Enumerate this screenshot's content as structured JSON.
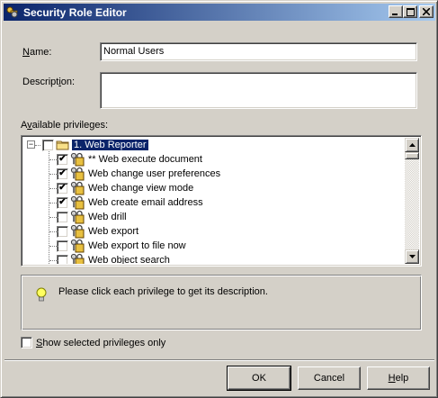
{
  "window": {
    "title": "Security Role Editor",
    "icon": "keys-role-icon",
    "controls": {
      "minimize": "_",
      "maximize": "□",
      "close": "×"
    }
  },
  "form": {
    "name_label": "Name:",
    "name_value": "Normal Users",
    "description_label": "Description:",
    "description_value": "",
    "privileges_label": "Available privileges:"
  },
  "tree": {
    "root": {
      "label": "1. Web Reporter",
      "checked": false,
      "expanded": true,
      "expander": "−",
      "icon": "folder-icon"
    },
    "items": [
      {
        "label": "** Web execute document",
        "checked": true,
        "icon": "lock-key-icon"
      },
      {
        "label": "Web change user preferences",
        "checked": true,
        "icon": "lock-key-icon"
      },
      {
        "label": "Web change view mode",
        "checked": true,
        "icon": "lock-key-icon"
      },
      {
        "label": "Web create email address",
        "checked": true,
        "icon": "lock-key-icon"
      },
      {
        "label": "Web drill",
        "checked": false,
        "icon": "lock-key-icon"
      },
      {
        "label": "Web export",
        "checked": false,
        "icon": "lock-key-icon"
      },
      {
        "label": "Web export to file now",
        "checked": false,
        "icon": "lock-key-icon"
      },
      {
        "label": "Web object search",
        "checked": false,
        "icon": "lock-key-icon"
      }
    ],
    "check_glyph": "✔"
  },
  "description_panel": {
    "text": "Please click each privilege to get its description.",
    "icon": "lightbulb-icon"
  },
  "options": {
    "show_selected_label": "Show selected privileges only",
    "show_selected_checked": false
  },
  "buttons": {
    "ok": "OK",
    "cancel": "Cancel",
    "help": "Help"
  }
}
